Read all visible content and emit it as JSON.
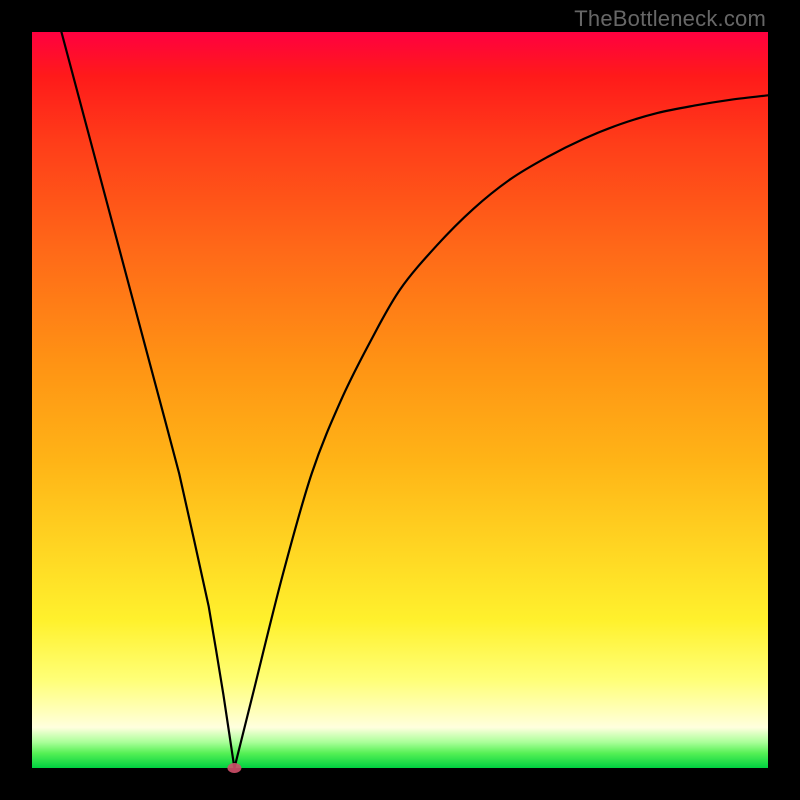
{
  "watermark": "TheBottleneck.com",
  "chart_data": {
    "type": "line",
    "title": "",
    "xlabel": "",
    "ylabel": "",
    "xlim": [
      0,
      100
    ],
    "ylim": [
      0,
      100
    ],
    "grid": false,
    "legend": null,
    "gradient_note": "vertical red→yellow→green background, green at bottom",
    "series": [
      {
        "name": "bottleneck-curve",
        "x": [
          4,
          8,
          12,
          16,
          20,
          24,
          26,
          27.5,
          30,
          34,
          38,
          42,
          46,
          50,
          55,
          60,
          65,
          70,
          75,
          80,
          85,
          90,
          95,
          100
        ],
        "values": [
          100,
          85,
          70,
          55,
          40,
          22,
          10,
          0,
          10,
          26,
          40,
          50,
          58,
          65,
          71,
          76,
          80,
          83,
          85.5,
          87.5,
          89,
          90,
          90.8,
          91.4
        ]
      }
    ],
    "min_point": {
      "x": 27.5,
      "y": 0
    }
  }
}
